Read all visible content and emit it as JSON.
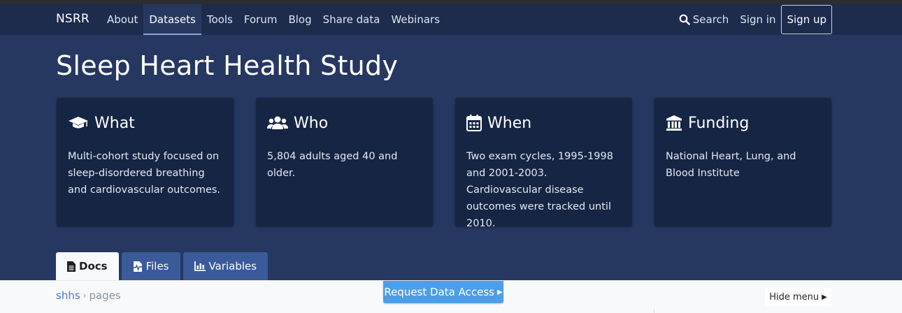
{
  "navbar": {
    "brand": "NSRR",
    "links": [
      "About",
      "Datasets",
      "Tools",
      "Forum",
      "Blog",
      "Share data",
      "Webinars"
    ],
    "active_link": "Datasets",
    "search_label": "Search",
    "signin_label": "Sign in",
    "signup_label": "Sign up"
  },
  "page": {
    "title": "Sleep Heart Health Study"
  },
  "cards": [
    {
      "icon": "graduation-cap-icon",
      "title": "What",
      "body": "Multi-cohort study focused on sleep-disordered breathing and cardiovascular outcomes."
    },
    {
      "icon": "users-icon",
      "title": "Who",
      "body": "5,804 adults aged 40 and older."
    },
    {
      "icon": "calendar-icon",
      "title": "When",
      "body": "Two exam cycles, 1995-1998 and 2001-2003. Cardiovascular disease outcomes were tracked until 2010."
    },
    {
      "icon": "university-icon",
      "title": "Funding",
      "body": "National Heart, Lung, and Blood Institute"
    }
  ],
  "tabs": [
    {
      "icon": "file-icon",
      "label": "Docs",
      "active": true
    },
    {
      "icon": "file-waveform-icon",
      "label": "Files",
      "active": false
    },
    {
      "icon": "bar-chart-icon",
      "label": "Variables",
      "active": false
    }
  ],
  "breadcrumb": {
    "root": "shhs",
    "separator": "›",
    "current": "pages"
  },
  "request_access_label": "Request Data Access",
  "hide_menu_label": "Hide menu",
  "colors": {
    "navbar": "#1d2b4d",
    "hero": "#263761",
    "card": "#172544",
    "tab": "#3a5a9a",
    "request_button": "#4d9ee8"
  }
}
